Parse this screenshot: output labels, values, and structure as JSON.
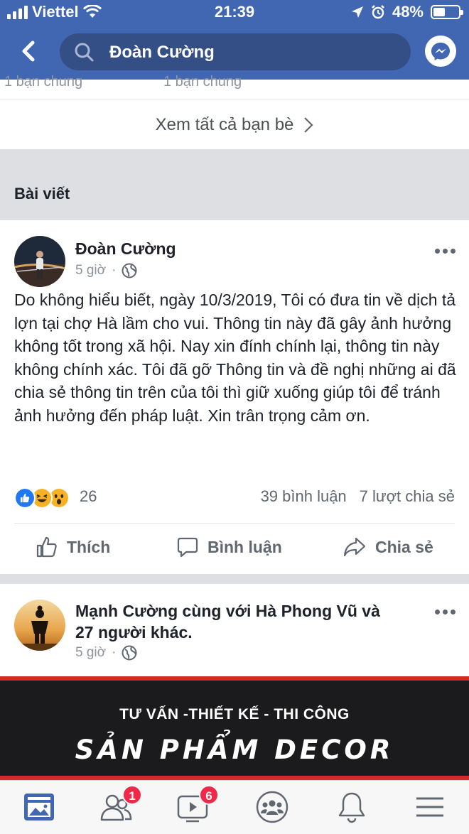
{
  "status_bar": {
    "carrier": "Viettel",
    "time": "21:39",
    "battery_percent": "48%",
    "battery_level": 0.48
  },
  "search": {
    "query": "Đoàn Cường"
  },
  "friends": {
    "mutual_left": "1 bạn chung",
    "mutual_right": "1 bạn chung",
    "see_all": "Xem tất cả bạn bè"
  },
  "section": {
    "title": "Bài viết"
  },
  "post1": {
    "author": "Đoàn Cường",
    "time": "5 giờ",
    "text": "Do không hiểu biết, ngày 10/3/2019, Tôi có đưa tin về dịch tả lợn tại chợ Hà lầm cho vui. Thông tin này đã gây ảnh hưởng không tốt trong xã hội. Nay xin đính chính lại, thông tin này không chính xác. Tôi đã gỡ Thông tin và đề nghị những ai đã chia sẻ thông tin trên của tôi thì giữ xuống giúp tôi để tránh ảnh hưởng đến pháp luật. Xin trân trọng cảm ơn.",
    "reaction_count": "26",
    "comments": "39 bình luận",
    "shares": "7 lượt chia sẻ"
  },
  "actions": {
    "like": "Thích",
    "comment": "Bình luận",
    "share": "Chia sẻ"
  },
  "post2": {
    "author_line1": "Mạnh Cường cùng với Hà Phong Vũ và",
    "author_line2": "27 người khác.",
    "time": "5 giờ"
  },
  "ad": {
    "line1": "TƯ VẤN -THIẾT KẾ - THI CÔNG",
    "line2": "SẢN PHẨM DECOR"
  },
  "tabbar": {
    "friends_badge": "1",
    "watch_badge": "6",
    "icons": [
      "news-feed-icon",
      "friend-requests-icon",
      "watch-icon",
      "groups-icon",
      "notifications-icon",
      "menu-icon"
    ]
  },
  "colors": {
    "brand_blue": "#4267b2",
    "search_bg": "#344e86",
    "badge_red": "#f02849",
    "like_blue": "#2078f4",
    "haha_yellow": "#f7b125"
  }
}
